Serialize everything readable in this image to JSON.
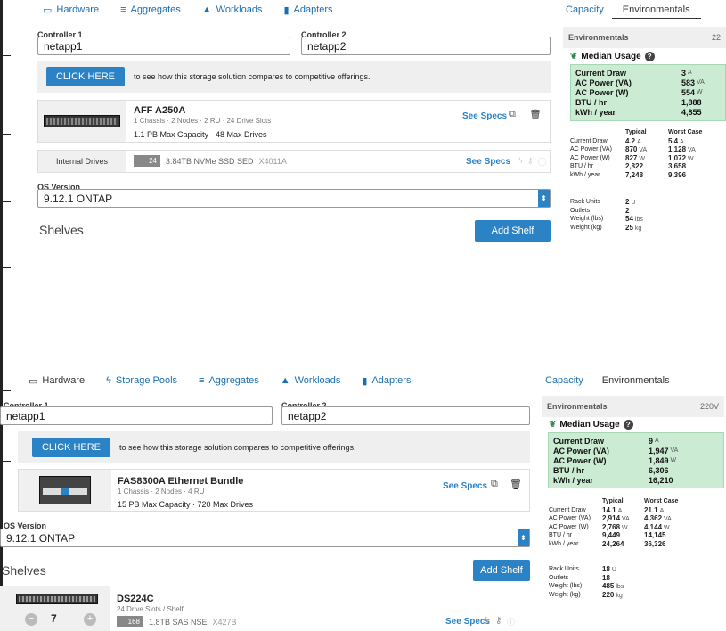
{
  "top": {
    "tabs": [
      {
        "icon": "▭",
        "label": "Hardware"
      },
      {
        "icon": "≡",
        "label": "Aggregates"
      },
      {
        "icon": "▲",
        "label": "Workloads"
      },
      {
        "icon": "▮",
        "label": "Adapters"
      }
    ],
    "right_tabs": [
      "Capacity",
      "Environmentals"
    ],
    "controller1_label": "Controller 1",
    "controller1_value": "netapp1",
    "controller2_label": "Controller 2",
    "controller2_value": "netapp2",
    "click_here": "CLICK HERE",
    "banner_text": "to see how this storage solution compares to competitive offerings.",
    "product_title": "AFF A250A",
    "product_sub": "1 Chassis · 2 Nodes · 2 RU · 24 Drive Slots",
    "product_cap": "1.1 PB Max Capacity · 48 Max Drives",
    "see_specs": "See Specs",
    "internal_drives": "Internal Drives",
    "drive_count": "24",
    "drive_desc": "3.84TB NVMe SSD SED",
    "drive_model": "X4011A",
    "os_label": "OS Version",
    "os_value": "9.12.1 ONTAP",
    "shelves": "Shelves",
    "add_shelf": "Add Shelf",
    "env_title": "Environmentals",
    "env_voltage": "22",
    "median": "Median Usage",
    "green": [
      {
        "k": "Current Draw",
        "v": "3",
        "u": "A"
      },
      {
        "k": "AC Power (VA)",
        "v": "583",
        "u": "VA"
      },
      {
        "k": "AC Power (W)",
        "v": "554",
        "u": "W"
      },
      {
        "k": "BTU / hr",
        "v": "1,888",
        "u": ""
      },
      {
        "k": "kWh / year",
        "v": "4,855",
        "u": ""
      }
    ],
    "typical": "Typical",
    "worst": "Worst Case",
    "rows": [
      {
        "k": "Current Draw",
        "t": "4.2",
        "tu": "A",
        "w": "5.4",
        "wu": "A"
      },
      {
        "k": "AC Power (VA)",
        "t": "870",
        "tu": "VA",
        "w": "1,128",
        "wu": "VA"
      },
      {
        "k": "AC Power (W)",
        "t": "827",
        "tu": "W",
        "w": "1,072",
        "wu": "W"
      },
      {
        "k": "BTU / hr",
        "t": "2,822",
        "tu": "",
        "w": "3,658",
        "wu": ""
      },
      {
        "k": "kWh / year",
        "t": "7,248",
        "tu": "",
        "w": "9,396",
        "wu": ""
      }
    ],
    "rows2": [
      {
        "k": "Rack Units",
        "t": "2",
        "tu": "U"
      },
      {
        "k": "Outlets",
        "t": "2",
        "tu": ""
      },
      {
        "k": "Weight (lbs)",
        "t": "54",
        "tu": "lbs"
      },
      {
        "k": "Weight (kg)",
        "t": "25",
        "tu": "kg"
      }
    ]
  },
  "bottom": {
    "tabs": [
      {
        "icon": "▭",
        "label": "Hardware"
      },
      {
        "icon": "ϟ",
        "label": "Storage Pools"
      },
      {
        "icon": "≡",
        "label": "Aggregates"
      },
      {
        "icon": "▲",
        "label": "Workloads"
      },
      {
        "icon": "▮",
        "label": "Adapters"
      }
    ],
    "right_tabs": [
      "Capacity",
      "Environmentals"
    ],
    "controller1_label": "Controller 1",
    "controller1_value": "netapp1",
    "controller2_label": "Controller 2",
    "controller2_value": "netapp2",
    "click_here": "CLICK HERE",
    "banner_text": "to see how this storage solution compares to competitive offerings.",
    "product_title": "FAS8300A Ethernet Bundle",
    "product_sub": "1 Chassis · 2 Nodes · 4 RU",
    "product_cap": "15 PB Max Capacity · 720 Max Drives",
    "see_specs": "See Specs",
    "os_label": "OS Version",
    "os_value": "9.12.1 ONTAP",
    "shelves": "Shelves",
    "add_shelf": "Add Shelf",
    "shelf_title": "DS224C",
    "shelf_sub": "24 Drive Slots / Shelf",
    "shelf_qty": "7",
    "drive_count": "168",
    "drive_desc": "1.8TB SAS NSE",
    "drive_model": "X427B",
    "env_title": "Environmentals",
    "env_voltage": "220V",
    "median": "Median Usage",
    "green": [
      {
        "k": "Current Draw",
        "v": "9",
        "u": "A"
      },
      {
        "k": "AC Power (VA)",
        "v": "1,947",
        "u": "VA"
      },
      {
        "k": "AC Power (W)",
        "v": "1,849",
        "u": "W"
      },
      {
        "k": "BTU / hr",
        "v": "6,306",
        "u": ""
      },
      {
        "k": "kWh / year",
        "v": "16,210",
        "u": ""
      }
    ],
    "typical": "Typical",
    "worst": "Worst Case",
    "rows": [
      {
        "k": "Current Draw",
        "t": "14.1",
        "tu": "A",
        "w": "21.1",
        "wu": "A"
      },
      {
        "k": "AC Power (VA)",
        "t": "2,914",
        "tu": "VA",
        "w": "4,362",
        "wu": "VA"
      },
      {
        "k": "AC Power (W)",
        "t": "2,768",
        "tu": "W",
        "w": "4,144",
        "wu": "W"
      },
      {
        "k": "BTU / hr",
        "t": "9,449",
        "tu": "",
        "w": "14,145",
        "wu": ""
      },
      {
        "k": "kWh / year",
        "t": "24,264",
        "tu": "",
        "w": "36,326",
        "wu": ""
      }
    ],
    "rows2": [
      {
        "k": "Rack Units",
        "t": "18",
        "tu": "U"
      },
      {
        "k": "Outlets",
        "t": "18",
        "tu": ""
      },
      {
        "k": "Weight (lbs)",
        "t": "485",
        "tu": "lbs"
      },
      {
        "k": "Weight (kg)",
        "t": "220",
        "tu": "kg"
      }
    ]
  }
}
